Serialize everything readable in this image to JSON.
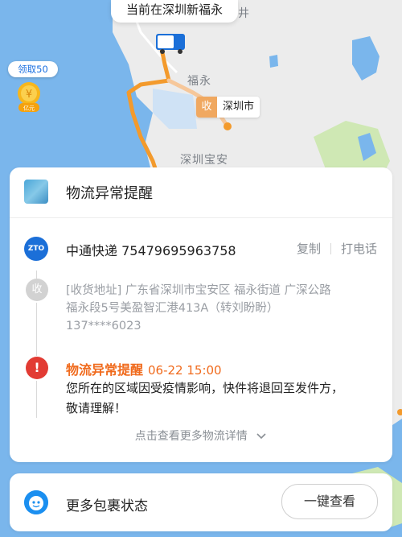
{
  "map": {
    "current_location": "当前在深圳新福永",
    "place_labels": [
      "福永",
      "深圳宝安",
      "井"
    ],
    "destination": {
      "icon_char": "收",
      "label": "深圳市"
    },
    "coupon": {
      "label": "领取50",
      "badge_text": "亿元"
    }
  },
  "card": {
    "title": "物流异常提醒",
    "courier": {
      "logo_text": "ZTO",
      "name_number": "中通快递 75479695963758",
      "copy_label": "复制",
      "call_label": "打电话"
    },
    "receiver": {
      "icon_char": "收",
      "address_line1": "[收货地址] 广东省深圳市宝安区  福永街道  广深公路",
      "address_line2": "福永段5号美盈智汇港413A（转刘盼盼）",
      "phone": "137****6023"
    },
    "alert": {
      "icon_char": "!",
      "title": "物流异常提醒",
      "time": "06-22 15:00",
      "body_line1": "您所在的区域因受疫情影响，快件将退回至发件方，",
      "body_line2": "敬请理解！"
    },
    "more_detail_label": "点击查看更多物流详情"
  },
  "card2": {
    "title": "更多包裹状态",
    "button_label": "一键查看"
  },
  "colors": {
    "sea": "#7ab6ec",
    "land": "#ececec",
    "route": "#f39a2c",
    "alert": "#f06a1c",
    "brand_blue": "#1b6fd8"
  }
}
